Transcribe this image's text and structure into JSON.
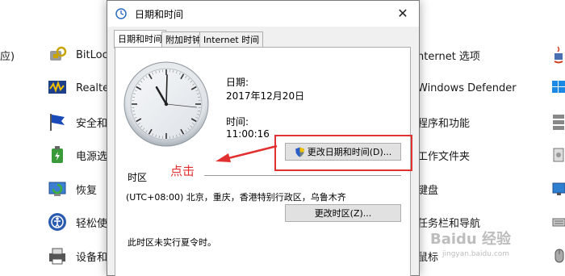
{
  "background_items": [
    {
      "label": "应)",
      "color": "#1a1a1a"
    },
    {
      "label": "BitLoc",
      "icon": "bitlocker-icon"
    },
    {
      "label": "Realte",
      "icon": "realtek-audio-icon"
    },
    {
      "label": "安全和",
      "icon": "security-flag-icon"
    },
    {
      "label": "电源选",
      "icon": "power-options-icon"
    },
    {
      "label": "恢复",
      "icon": "recovery-icon"
    },
    {
      "label": "轻松使",
      "icon": "ease-of-access-icon"
    },
    {
      "label": "设备和",
      "icon": "devices-printers-icon"
    },
    {
      "label": "nternet 选项"
    },
    {
      "label": "Windows Defender"
    },
    {
      "label": "程序和功能"
    },
    {
      "label": "工作文件夹"
    },
    {
      "label": "键盘"
    },
    {
      "label": "任务栏和导航"
    },
    {
      "label": "鼠标"
    }
  ],
  "dialog": {
    "title": "日期和时间",
    "tabs": [
      "日期和时间",
      "附加时钟",
      "Internet 时间"
    ],
    "date_label": "日期:",
    "date_value": "2017年12月20日",
    "time_label": "时间:",
    "time_value": "11:00:16",
    "change_datetime_button": "更改日期和时间(D)...",
    "timezone_section": "时区",
    "timezone_value": "(UTC+08:00) 北京，重庆，香港特别行政区，乌鲁木齐",
    "change_timezone_button": "更改时区(Z)...",
    "dst_note": "此时区未实行夏令时。"
  },
  "clock": {
    "hour": 11,
    "minute": 0,
    "second": 16
  },
  "annotation": {
    "text": "点击",
    "color": "#e03030"
  },
  "watermark": {
    "brand": "Baidu 经验",
    "url": "jingyan.baidu.com"
  }
}
